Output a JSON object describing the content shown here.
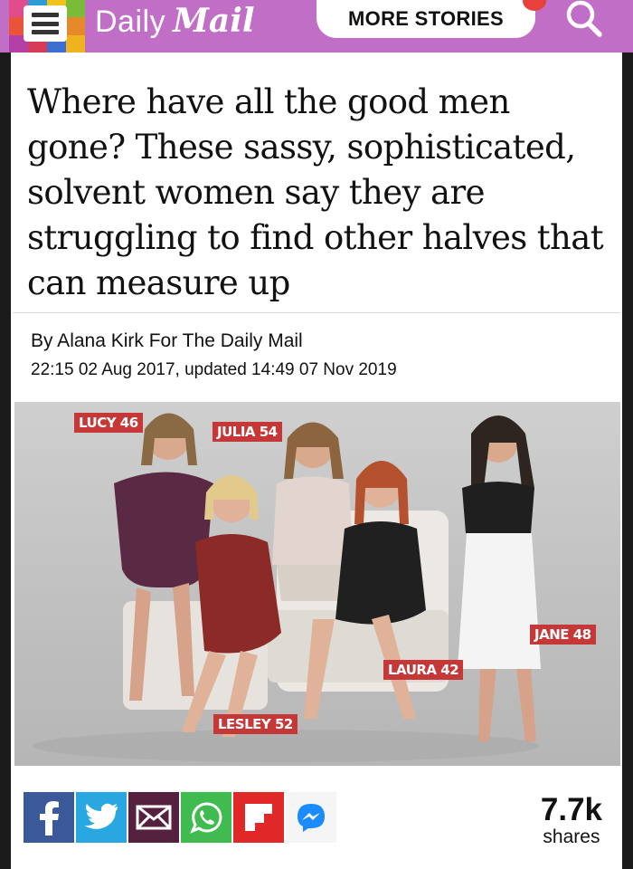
{
  "header": {
    "logo_daily": "Daily",
    "logo_mail": "Mail",
    "more_stories": "MORE STORIES",
    "colors": {
      "bar": "#c16fc6",
      "accent_dot": "#e8403a"
    }
  },
  "article": {
    "headline": "Where have all the good men gone? These sassy, sophisticated, solvent women say they are struggling to find other halves that can measure up",
    "byline": "By Alana Kirk For The Daily Mail",
    "dateline": "22:15 02 Aug 2017, updated 14:49 07 Nov 2019"
  },
  "photo": {
    "labels": [
      "LUCY 46",
      "JULIA 54",
      "JANE 48",
      "LAURA 42",
      "LESLEY 52"
    ],
    "label_color": "#c63838"
  },
  "share": {
    "buttons": [
      "facebook-icon",
      "twitter-icon",
      "email-icon",
      "whatsapp-icon",
      "flipboard-icon",
      "messenger-icon"
    ],
    "count": "7.7k",
    "count_label": "shares"
  }
}
